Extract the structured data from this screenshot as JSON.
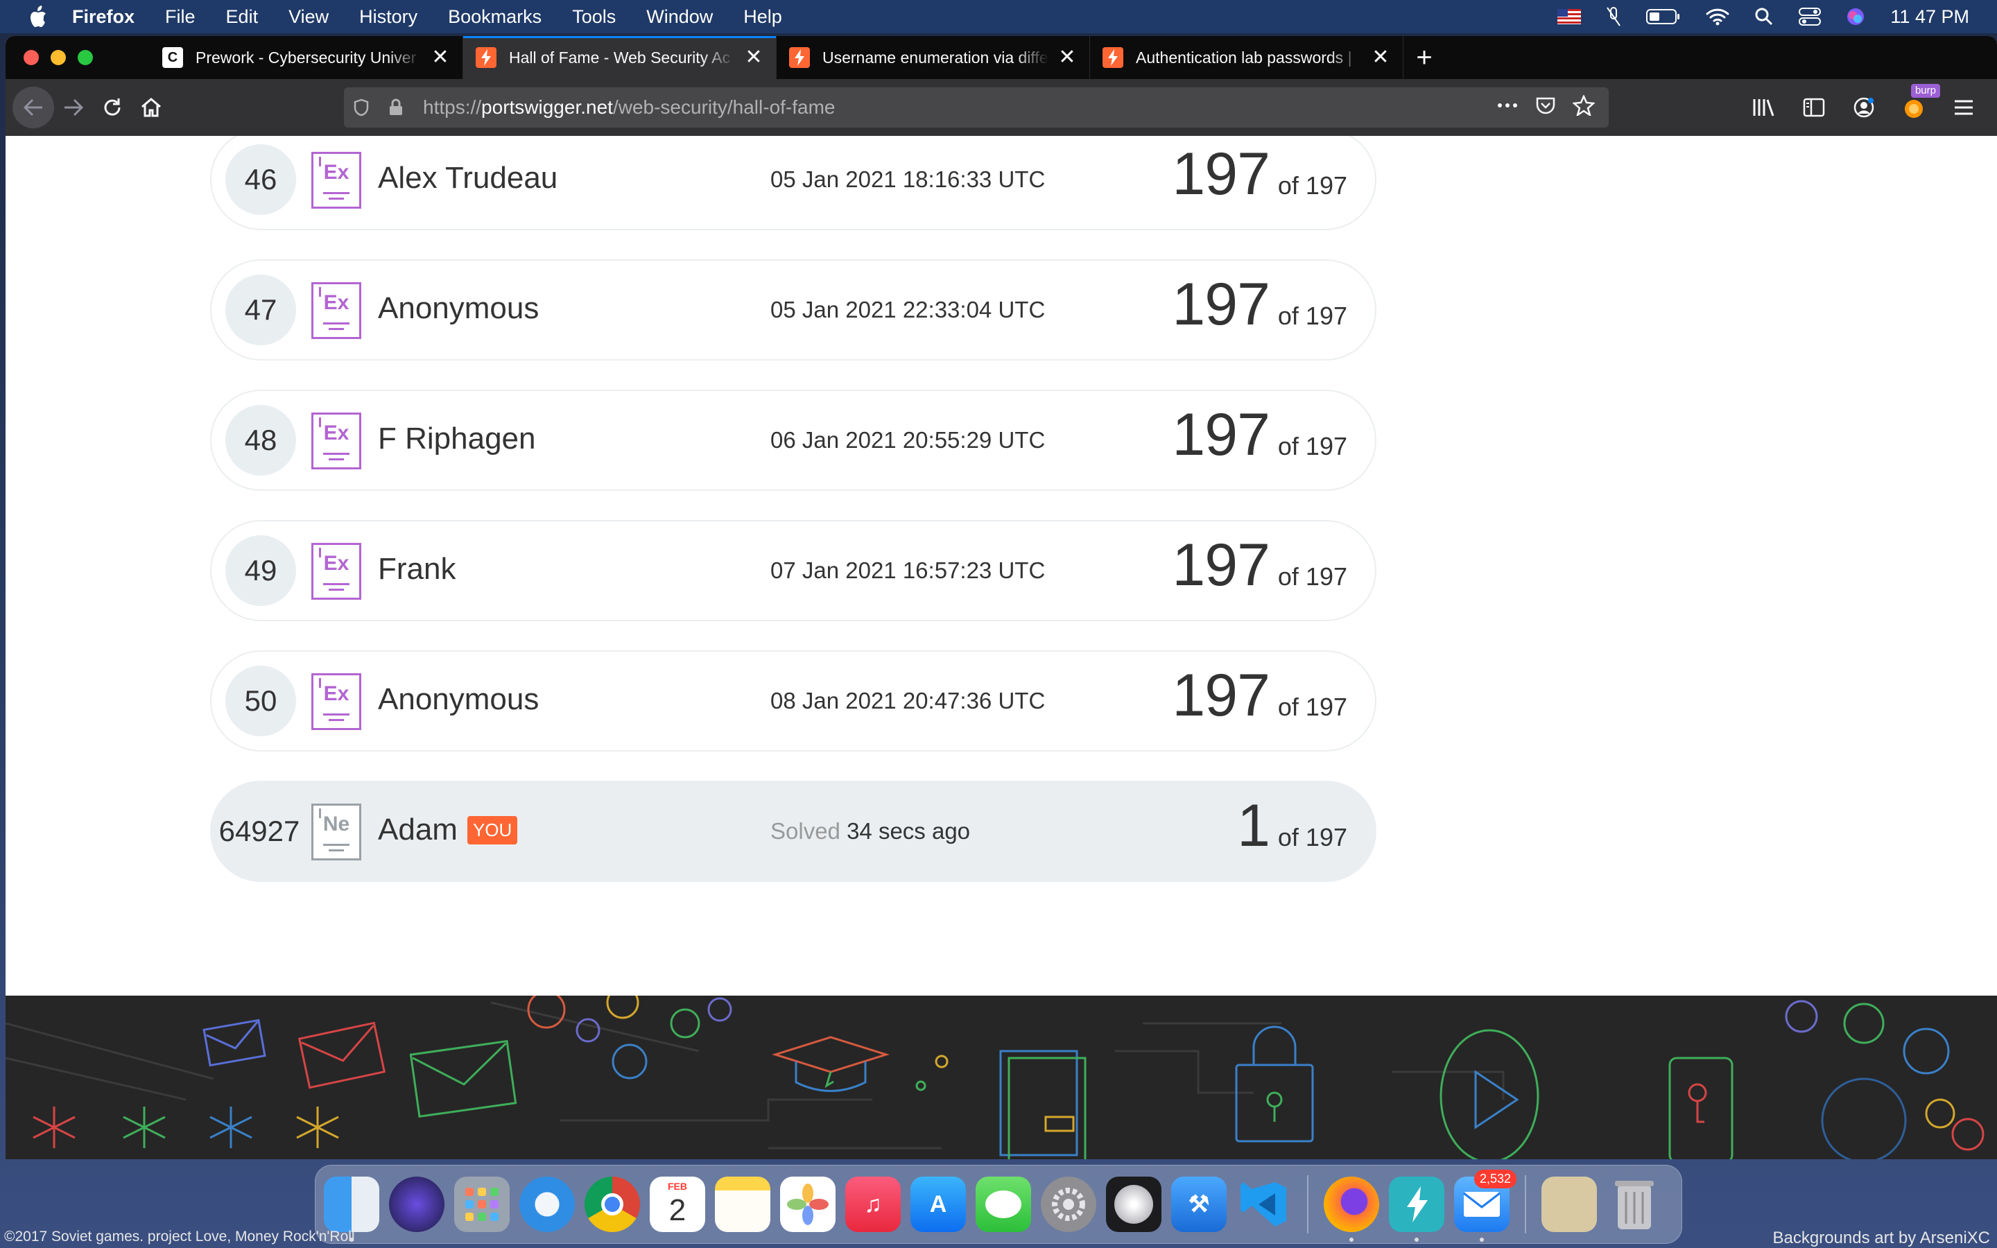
{
  "menubar": {
    "app_name": "Firefox",
    "menus": [
      "File",
      "Edit",
      "View",
      "History",
      "Bookmarks",
      "Tools",
      "Window",
      "Help"
    ],
    "clock": "11 47 PM",
    "status_icons": [
      "flag-us-icon",
      "mute-icon",
      "battery-icon",
      "wifi-icon",
      "search-icon",
      "control-center-icon",
      "siri-icon"
    ]
  },
  "browser": {
    "tabs": [
      {
        "title": "Prework - Cybersecurity Univer",
        "favicon": "C",
        "active": false
      },
      {
        "title": "Hall of Fame - Web Security Ac",
        "favicon": "PS",
        "active": true
      },
      {
        "title": "Username enumeration via diffe",
        "favicon": "PS",
        "active": false
      },
      {
        "title": "Authentication lab passwords |",
        "favicon": "PS",
        "active": false
      }
    ],
    "close_glyph": "✕",
    "newtab_glyph": "+",
    "url_scheme": "https://",
    "url_host": "portswigger.net",
    "url_path": "/web-security/hall-of-fame",
    "burp_badge": "burp"
  },
  "leaderboard": {
    "rows": [
      {
        "rank": "46",
        "badge": "Ex",
        "name": "Alex Trudeau",
        "time": "05 Jan 2021 18:16:33 UTC",
        "solved": "197",
        "of": "of 197"
      },
      {
        "rank": "47",
        "badge": "Ex",
        "name": "Anonymous",
        "time": "05 Jan 2021 22:33:04 UTC",
        "solved": "197",
        "of": "of 197"
      },
      {
        "rank": "48",
        "badge": "Ex",
        "name": "F Riphagen",
        "time": "06 Jan 2021 20:55:29 UTC",
        "solved": "197",
        "of": "of 197"
      },
      {
        "rank": "49",
        "badge": "Ex",
        "name": "Frank",
        "time": "07 Jan 2021 16:57:23 UTC",
        "solved": "197",
        "of": "of 197"
      },
      {
        "rank": "50",
        "badge": "Ex",
        "name": "Anonymous",
        "time": "08 Jan 2021 20:47:36 UTC",
        "solved": "197",
        "of": "of 197"
      }
    ],
    "you_row": {
      "rank": "64927",
      "badge": "Ne",
      "name": "Adam",
      "you_tag": "YOU",
      "solved_label": "Solved",
      "solved_time": "34 secs ago",
      "solved": "1",
      "of": "of 197"
    }
  },
  "dock": {
    "calendar_month": "FEB",
    "calendar_day": "2",
    "mail_badge": "2,532"
  },
  "desktop": {
    "credit_left": "©2017 Soviet games. project Love, Money Rock'n'Roll",
    "credit_right": "Backgrounds art by ArseniXC"
  },
  "colors": {
    "accent_orange": "#ff6633",
    "expert_badge": "#b365d1",
    "novice_badge": "#9aa0a6",
    "active_tab_line": "#0a84ff"
  }
}
